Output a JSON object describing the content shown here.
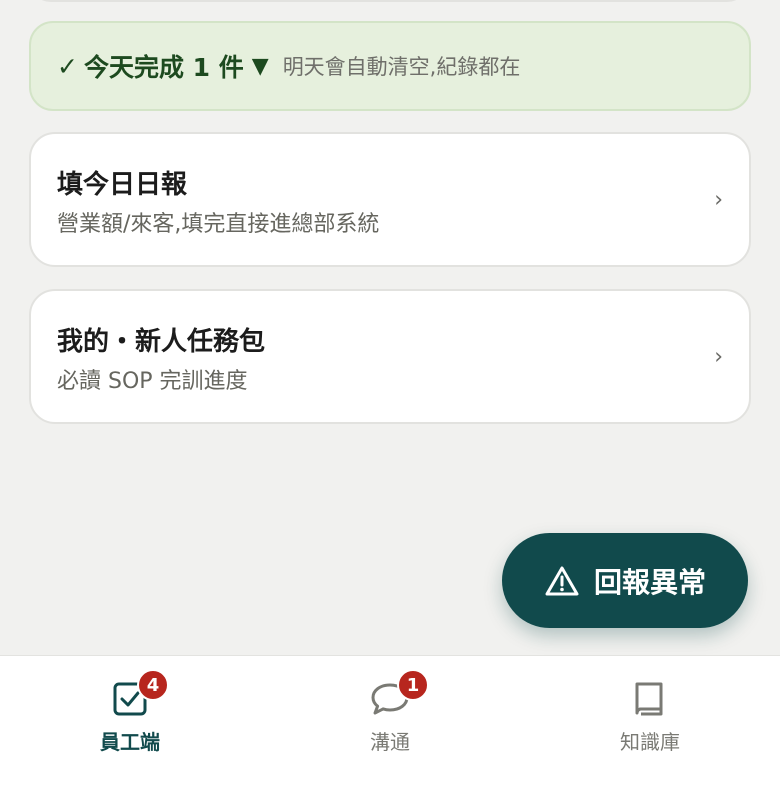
{
  "done_banner": {
    "check": "✓",
    "strong_text": "今天完成 1 件",
    "toggle": "▼",
    "note": "明天會自動清空,紀錄都在"
  },
  "cards": [
    {
      "title": "填今日日報",
      "subtitle": "營業額/來客,填完直接進總部系統",
      "chevron": "›"
    },
    {
      "title": "我的・新人任務包",
      "subtitle": "必讀 SOP 完訓進度",
      "chevron": "›"
    }
  ],
  "report_button": {
    "label": "回報異常",
    "icon": "warning-triangle-icon"
  },
  "tabs": [
    {
      "label": "員工端",
      "icon": "checkbox-icon",
      "badge": "4",
      "active": true
    },
    {
      "label": "溝通",
      "icon": "chat-bubble-icon",
      "badge": "1",
      "active": false
    },
    {
      "label": "知識庫",
      "icon": "book-icon",
      "badge": "",
      "active": false
    }
  ],
  "colors": {
    "accent": "#114a4c",
    "badge": "#b7261e",
    "done_bg": "#e6f0dd",
    "done_text": "#1d4a1f",
    "page_bg": "#f1f1ef"
  }
}
